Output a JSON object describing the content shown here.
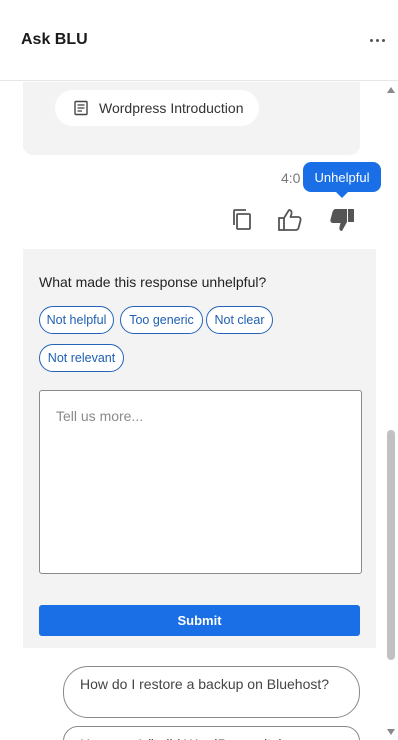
{
  "header": {
    "title": "Ask BLU",
    "more_icon": "more-horizontal-icon"
  },
  "sources": {
    "chip_label": "Wordpress Introduction",
    "chip_icon": "document-icon"
  },
  "message": {
    "time": "4:0",
    "tooltip": "Unhelpful",
    "actions": {
      "copy_icon": "copy-icon",
      "like_icon": "thumbs-up-icon",
      "dislike_icon": "thumbs-down-icon"
    }
  },
  "feedback": {
    "question": "What made this response unhelpful?",
    "options": [
      "Not helpful",
      "Too generic",
      "Not clear",
      "Not relevant"
    ],
    "textarea_placeholder": "Tell us more...",
    "textarea_value": "",
    "submit_label": "Submit"
  },
  "suggestions": [
    "How do I restore a backup on Bluehost?",
    "How can I (build WordPress site)..."
  ],
  "colors": {
    "accent": "#1a6fe6",
    "card": "#f3f3f3",
    "pill_border": "#2563b8"
  }
}
